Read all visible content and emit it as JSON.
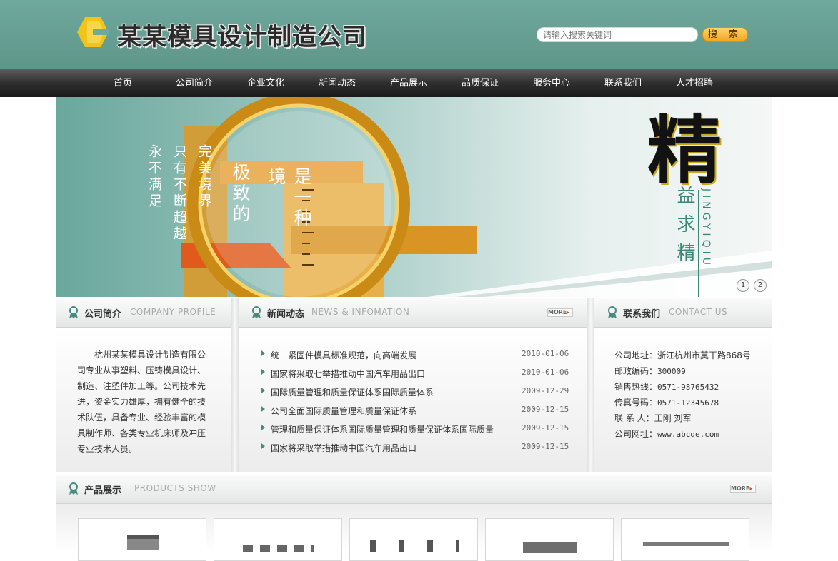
{
  "header": {
    "title": "某某模具设计制造公司",
    "search_placeholder": "请输入搜索关键词",
    "search_button": "搜 索"
  },
  "nav": [
    "首页",
    "公司简介",
    "企业文化",
    "新闻动态",
    "产品展示",
    "品质保证",
    "服务中心",
    "联系我们",
    "人才招聘"
  ],
  "banner": {
    "col1": "永不满足",
    "col2": "只有不断超越",
    "col3": "完美境界",
    "col4": "极致的",
    "col5": "是一种境",
    "big_char": "精",
    "col6": "益求精",
    "pinyin": "JINGYIQIU",
    "pager": [
      "1",
      "2"
    ]
  },
  "profile": {
    "title": "公司简介",
    "en": "COMPANY PROFILE",
    "text": "杭州某某模具设计制造有限公司专业从事塑料、压铸模具设计、制造、注塑件加工等。公司技术先进，资金实力雄厚，拥有健全的技术队伍，具备专业、经验丰富的模具制作师、各类专业机床师及冲压专业技术人员。"
  },
  "news": {
    "title": "新闻动态",
    "en": "NEWS & INFOMATION",
    "more": "MORE",
    "items": [
      {
        "title": "统一紧固件模具标准规范，向高端发展",
        "date": "2010-01-06"
      },
      {
        "title": "国家将采取七举措推动中国汽车用品出口",
        "date": "2010-01-06"
      },
      {
        "title": "国际质量管理和质量保证体系国际质量体系",
        "date": "2009-12-29"
      },
      {
        "title": "公司全面国际质量管理和质量保证体系",
        "date": "2009-12-15"
      },
      {
        "title": "管理和质量保证体系国际质量管理和质量保证体系国际质量",
        "date": "2009-12-15"
      },
      {
        "title": "国家将采取举措推动中国汽车用品出口",
        "date": "2009-12-15"
      }
    ]
  },
  "contact": {
    "title": "联系我们",
    "en": "CONTACT US",
    "rows": [
      {
        "label": "公司地址：",
        "value": "浙江杭州市莫干路868号"
      },
      {
        "label": "邮政编码：",
        "value": "300009"
      },
      {
        "label": "销售热线：",
        "value": "0571-98765432"
      },
      {
        "label": "传真号码：",
        "value": "0571-12345678"
      },
      {
        "label": "联 系 人：",
        "value": "王刚 刘军"
      },
      {
        "label": "公司网址：",
        "value": "www.abcde.com"
      }
    ]
  },
  "products": {
    "title": "产品展示",
    "en": "PRODUCTS SHOW",
    "more": "MORE"
  },
  "colors": {
    "header_teal": "#6fa89c",
    "accent_orange": "#f4a51c",
    "nav_dark": "#2e2e2e"
  }
}
